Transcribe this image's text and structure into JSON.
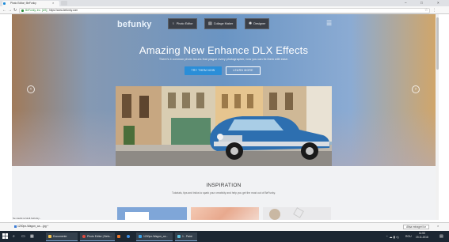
{
  "browser": {
    "tab_title": "Photo Editor | BeFunky",
    "tab_close": "×",
    "window_controls": [
      "–",
      "□",
      "×"
    ],
    "nav": {
      "back": "←",
      "forward": "→",
      "reload": "↻"
    },
    "secure_label": "BeFunky, Inc. [US]",
    "url_separator": "|",
    "url": "https://www.befunky.com",
    "star": "☆",
    "menu": "⋮"
  },
  "site": {
    "logo": "befunky",
    "nav": [
      {
        "label": "Photo Editor",
        "icon": "lightbulb-icon",
        "glyph": "♁"
      },
      {
        "label": "Collage Maker",
        "icon": "collage-icon",
        "glyph": "▤"
      },
      {
        "label": "Designer",
        "icon": "sparkle-icon",
        "glyph": "✺"
      }
    ],
    "hamburger": "☰"
  },
  "hero": {
    "title": "Amazing New Enhance DLX Effects",
    "subtitle": "There's 4 common photo issues that plague every photographer, now you can fix them with ease.",
    "primary_button": "TRY THEM NOW",
    "secondary_button": "LEARN MORE",
    "prev_arrow": "‹",
    "next_arrow": "›"
  },
  "inspiration": {
    "title": "INSPIRATION",
    "subtitle": "Tutorials, tips and tricks to spark your creativity and help you get the most out of BeFunky."
  },
  "status_text": "Se caută rezolvă befunky...",
  "downloads": {
    "file": "1200px-Wagon_ca....jpg",
    "chevron": "^",
    "show_all": "Afișa extrageri lor",
    "close": "×"
  },
  "taskbar": {
    "items": [
      {
        "label": "Documente",
        "color": "#f2c14e"
      },
      {
        "label": "Photo Editor | Befu...",
        "color": "#e04a3f"
      },
      {
        "label": "",
        "color": "#e8752a"
      },
      {
        "label": "",
        "color": "#3a8ee6"
      },
      {
        "label": "1200px-Wagon_ca...",
        "color": "#3aa0e6"
      },
      {
        "label": "1 - Paint",
        "color": "#5cc0e0"
      }
    ],
    "tray_text": "ROU",
    "time": "11:55",
    "date": "19.11.2018"
  },
  "colors": {
    "accent": "#2a8ed8",
    "nav_pill": "#3b3f47",
    "taskbar": "#1c2733"
  }
}
